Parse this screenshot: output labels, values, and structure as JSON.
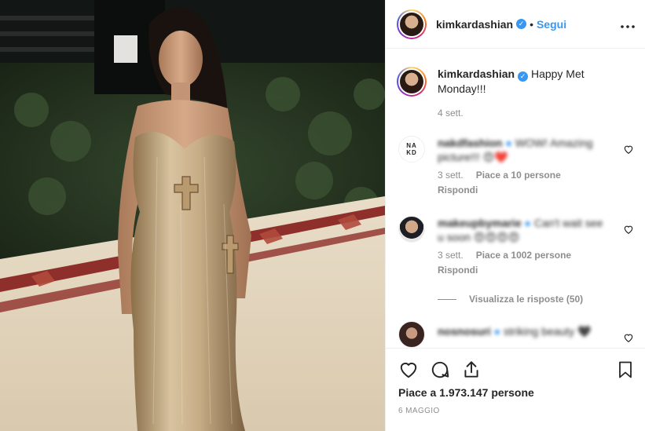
{
  "post": {
    "username": "kimkardashian",
    "verified_mark": "✓",
    "dot": "•",
    "follow_label": "Segui",
    "more_label": "•••"
  },
  "caption": {
    "username": "kimkardashian",
    "text": "Happy Met Monday!!!",
    "time": "4 sett."
  },
  "comments": [
    {
      "username": "nakdfashion",
      "text": "WOW! Amazing picture!!! 😍❤️",
      "time": "3 sett.",
      "likes": "Piace a 10 persone",
      "reply_label": "Rispondi",
      "avatar_text": "NA KD"
    },
    {
      "username": "makeupbymarie",
      "text": "Can't wait see u soon 😍😍😍😍",
      "time": "3 sett.",
      "likes": "Piace a 1002 persone",
      "reply_label": "Rispondi"
    },
    {
      "username": "nosnosuri",
      "text": "striking beauty 🖤"
    }
  ],
  "view_replies_label": "Visualizza le risposte (50)",
  "footer": {
    "likes": "Piace a 1.973.147 persone",
    "date": "6 MAGGIO"
  },
  "icons": [
    "heart-icon",
    "comment-icon",
    "share-icon",
    "bookmark-icon",
    "more-options-icon",
    "verified-badge-icon"
  ],
  "colors": {
    "link": "#3897f0",
    "muted": "#8e8e8e",
    "text": "#262626",
    "border": "#efefef"
  }
}
